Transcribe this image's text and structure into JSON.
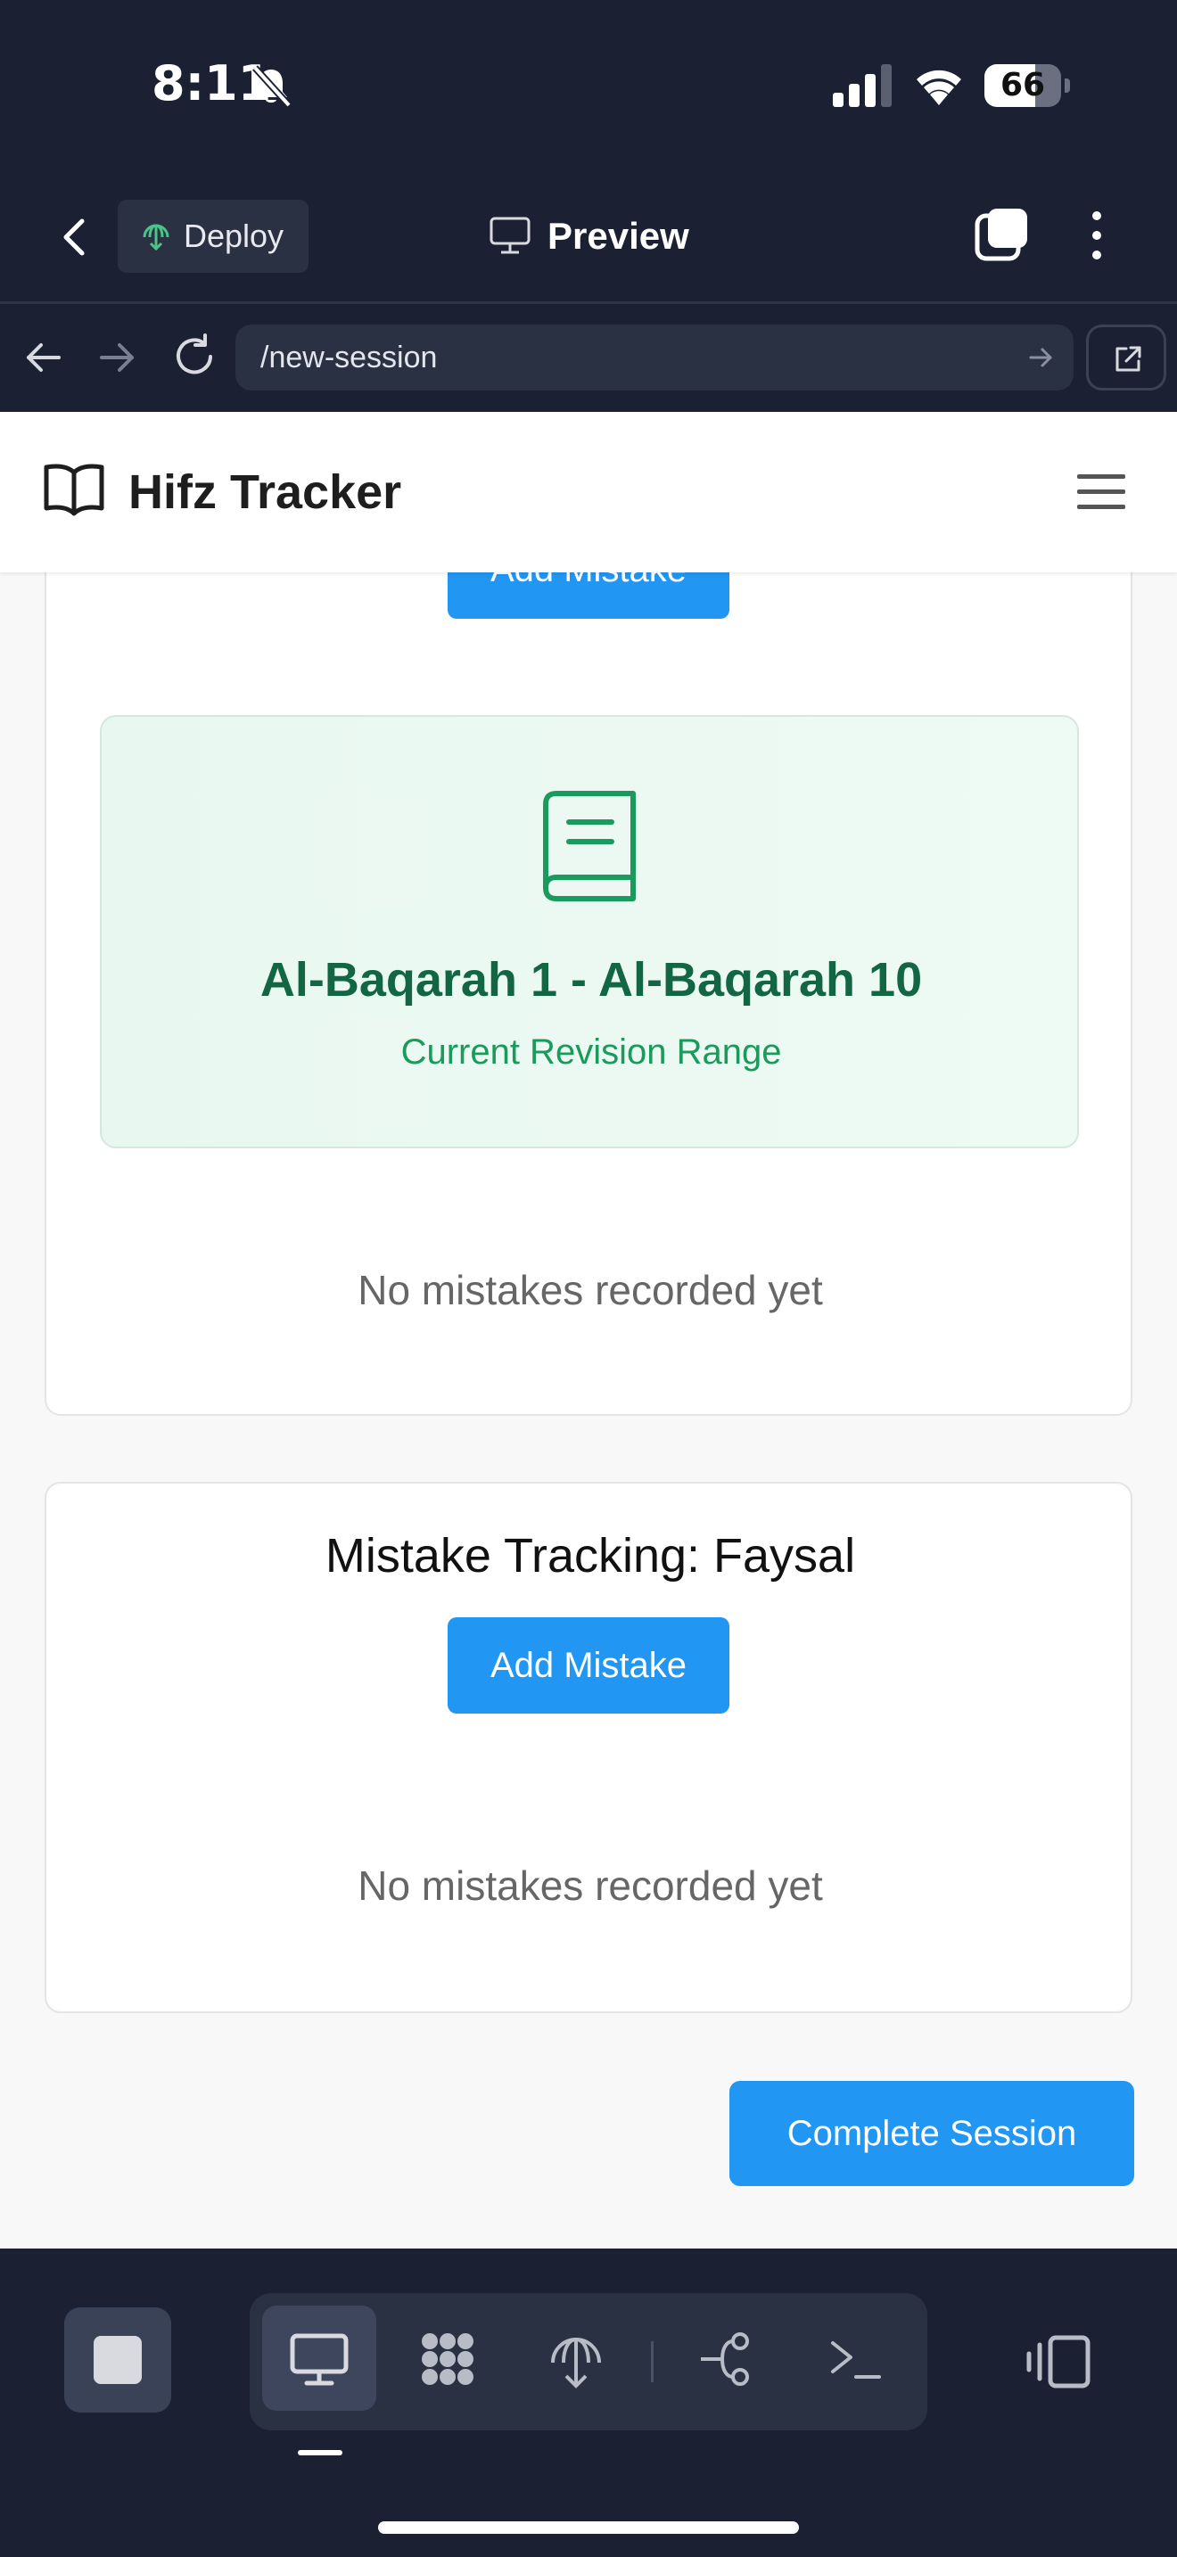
{
  "status_bar": {
    "time": "8:11",
    "battery": "66",
    "battery_level": 0.66
  },
  "top_bar": {
    "deploy_label": "Deploy",
    "preview_label": "Preview"
  },
  "url_bar": {
    "url": "/new-session"
  },
  "site": {
    "brand": "Hifz Tracker"
  },
  "card1": {
    "add_mistake_label": "Add Mistake",
    "range_title": "Al-Baqarah 1 - Al-Baqarah 10",
    "range_subtitle": "Current Revision Range",
    "empty_message": "No mistakes recorded yet"
  },
  "card2": {
    "title": "Mistake Tracking: Faysal",
    "add_mistake_label": "Add Mistake",
    "empty_message": "No mistakes recorded yet"
  },
  "complete_session_label": "Complete Session",
  "colors": {
    "accent_blue": "#2196f3",
    "range_green": "#126643",
    "dark_bg": "#1b2133"
  }
}
